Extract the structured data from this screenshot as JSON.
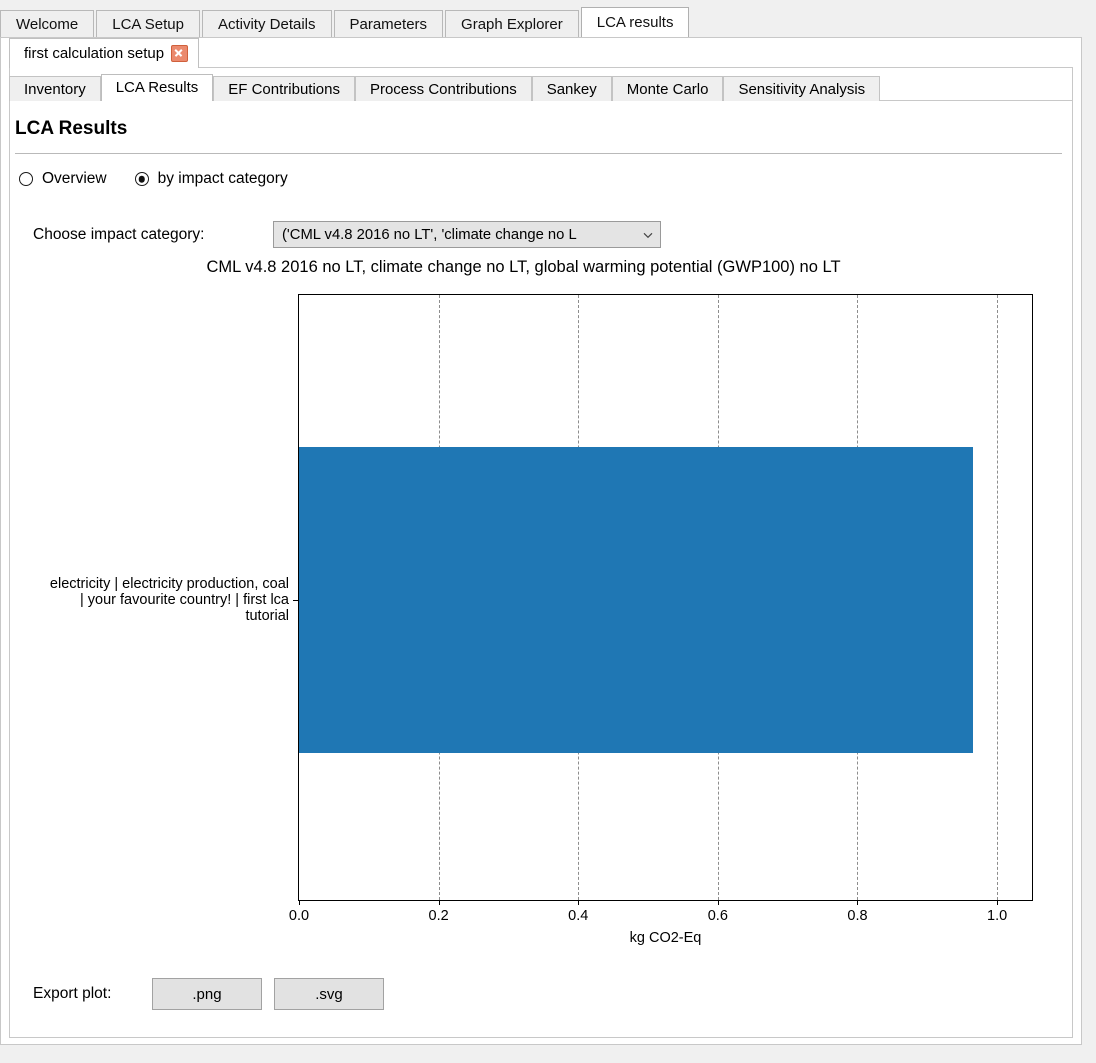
{
  "top_tabs": [
    {
      "label": "Welcome",
      "active": false
    },
    {
      "label": "LCA Setup",
      "active": false
    },
    {
      "label": "Activity Details",
      "active": false
    },
    {
      "label": "Parameters",
      "active": false
    },
    {
      "label": "Graph Explorer",
      "active": false
    },
    {
      "label": "LCA results",
      "active": true
    }
  ],
  "setup_tab": {
    "label": "first calculation setup",
    "close_icon": "close-icon"
  },
  "sub_tabs": [
    {
      "label": "Inventory",
      "active": false
    },
    {
      "label": "LCA Results",
      "active": true
    },
    {
      "label": "EF Contributions",
      "active": false
    },
    {
      "label": "Process Contributions",
      "active": false
    },
    {
      "label": "Sankey",
      "active": false
    },
    {
      "label": "Monte Carlo",
      "active": false
    },
    {
      "label": "Sensitivity Analysis",
      "active": false
    }
  ],
  "page": {
    "title": "LCA Results"
  },
  "view_mode": {
    "options": [
      {
        "label": "Overview",
        "selected": false
      },
      {
        "label": "by impact category",
        "selected": true
      }
    ]
  },
  "impact_category": {
    "label": "Choose impact category:",
    "selected": "('CML v4.8 2016 no LT', 'climate change no L",
    "chevron_icon": "chevron-down-icon"
  },
  "export": {
    "label": "Export plot:",
    "png_label": ".png",
    "svg_label": ".svg"
  },
  "colors": {
    "bar": "#1f77b4",
    "accent": "#eb8a6e"
  },
  "chart_data": {
    "type": "bar",
    "orientation": "horizontal",
    "title": "CML v4.8 2016 no LT, climate change no LT, global warming potential (GWP100) no LT",
    "xlabel": "kg CO2-Eq",
    "ylabel": "",
    "categories": [
      "electricity | electricity production, coal | your favourite country! | first lca tutorial"
    ],
    "values": [
      0.966
    ],
    "xlim": [
      0.0,
      1.05
    ],
    "xticks": [
      0.0,
      0.2,
      0.4,
      0.6,
      0.8,
      1.0
    ],
    "xtick_labels": [
      "0.0",
      "0.2",
      "0.4",
      "0.6",
      "0.8",
      "1.0"
    ],
    "grid": "vertical-dashed",
    "legend": null,
    "bar_color": "#1f77b4"
  }
}
